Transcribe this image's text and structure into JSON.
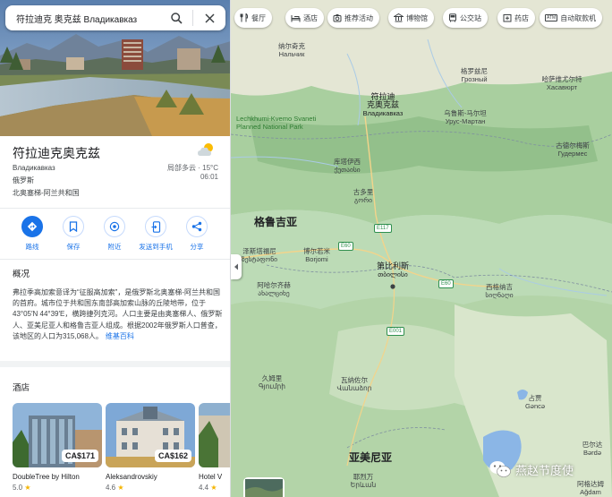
{
  "search": {
    "value": "符拉迪克 奥克兹 Владикавказ"
  },
  "place": {
    "title": "符拉迪克奥克兹",
    "local_name": "Владикавказ",
    "country": "俄罗斯",
    "region": "北奥塞梯-阿兰共和国",
    "weather": {
      "text": "局部多云 · 15°C",
      "time": "06:01",
      "icon": "partly-cloudy-icon"
    }
  },
  "actions": [
    {
      "label": "路线",
      "icon": "directions-icon"
    },
    {
      "label": "保存",
      "icon": "bookmark-icon"
    },
    {
      "label": "附近",
      "icon": "nearby-icon"
    },
    {
      "label": "发送到手机",
      "icon": "send-to-phone-icon"
    },
    {
      "label": "分享",
      "icon": "share-icon"
    }
  ],
  "overview": {
    "heading": "概况",
    "text": "弗拉季高加索意译为“征服高加索”，是俄罗斯北奥塞梯-阿兰共和国的首府。城市位于共和国东南部高加索山脉的丘陵地带，位于43°05′N 44°39′E，横跨捷列克河。人口主要是由奥塞梯人、俄罗斯人、亚美尼亚人和格鲁吉亚人组成。根据2002年俄罗斯人口普查，该地区的人口为315,068人。",
    "source": "维基百科"
  },
  "hotels": {
    "heading": "酒店",
    "items": [
      {
        "name": "DoubleTree by Hilton",
        "price": "CA$171",
        "rating": "5.0"
      },
      {
        "name": "Aleksandrovskiy",
        "price": "CA$162",
        "rating": "4.6"
      },
      {
        "name": "Hotel V",
        "price": "",
        "rating": "4.4"
      }
    ]
  },
  "chips": [
    {
      "label": "餐厅",
      "icon": "restaurant-icon"
    },
    {
      "label": "酒店",
      "icon": "hotel-icon"
    },
    {
      "label": "推荐活动",
      "icon": "activities-icon"
    },
    {
      "label": "博物馆",
      "icon": "museum-icon"
    },
    {
      "label": "公交站",
      "icon": "transit-icon"
    },
    {
      "label": "药店",
      "icon": "pharmacy-icon"
    },
    {
      "label": "自动取款机",
      "icon": "atm-icon"
    }
  ],
  "map_labels": {
    "nalchik_zh": "纳尔奇克",
    "nalchik_ru": "Нальчик",
    "grozny_zh": "格罗兹尼",
    "grozny_ru": "Грозный",
    "khasavyurt_zh": "哈萨维尤尔特",
    "khasavyurt_ru": "Хасавюрт",
    "vlad_zh": "符拉迪",
    "vlad_zh2": "克奥克兹",
    "vlad_ru": "Владикавказ",
    "urus_zh": "乌鲁斯-马尔坦",
    "urus_ru": "Урус-Мартан",
    "gudermes_zh": "古德尔梅斯",
    "gudermes_ru": "Гудермес",
    "park": "Lechkhumi-Kvemo Svaneti Planned National Park",
    "kutaisi_zh": "库塔伊西",
    "kutaisi_geo": "ქუთაისი",
    "zestaponi_zh": "泽斯塔福尼",
    "zestaponi_geo": "ზესტაფონი",
    "gori_zh": "古多里",
    "gori_geo": "გორი",
    "georgia": "格鲁吉亚",
    "tbilisi_zh": "第比利斯",
    "tbilisi_geo": "თბილისი",
    "batumi_zh": "博尔若米",
    "batumi_geo": "Borjomi",
    "akhal_zh": "阿哈尔齐赫",
    "akhal_geo": "ახალციხე",
    "sighnaghi_zh": "西格纳吉",
    "sighnaghi_geo": "სიღნაღი",
    "gyumri_zh": "久姆里",
    "gyumri_arm": "Գյումրի",
    "vanadzor_zh": "瓦纳佐尔",
    "vanadzor_arm": "Վանաձոր",
    "gence_zh": "占贾",
    "gence_az": "Gəncə",
    "armenia": "亚美尼亚",
    "yerevan_zh": "耶烈万",
    "yerevan_arm": "Երևան",
    "barda_zh": "巴尔达",
    "barda_az": "Bərdə",
    "stepanakert_zh": "阿格达姆",
    "stepanakert_az": "Ağdam"
  },
  "roads": [
    "E117",
    "E60",
    "E60",
    "E001"
  ],
  "watermark": {
    "text": "燕赵节度使",
    "icon": "wechat-icon"
  }
}
